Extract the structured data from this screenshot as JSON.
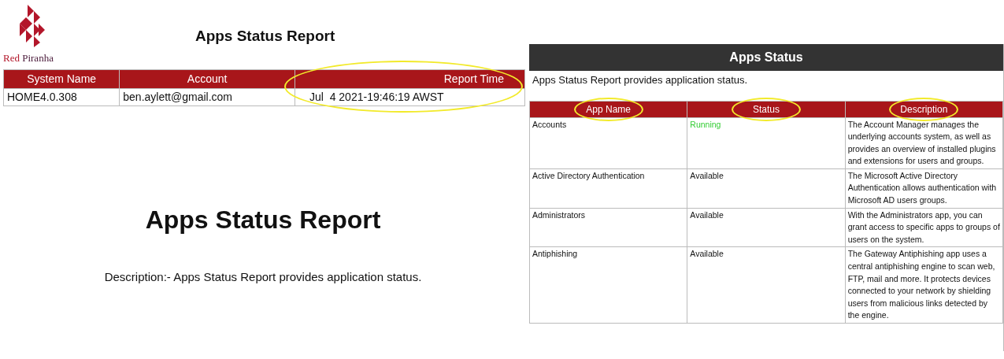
{
  "logo": {
    "word_1": "Red",
    "word_2": "Piranha"
  },
  "header_title": "Apps Status Report",
  "summary_table": {
    "columns": [
      {
        "label": "System Name",
        "circled": false
      },
      {
        "label": "Account",
        "circled": false
      },
      {
        "label": "Report Time",
        "circled": true
      }
    ],
    "row": [
      "HOME4.0.308",
      "ben.aylett@gmail.com",
      "Jul  4 2021-19:46:19 AWST"
    ]
  },
  "cover_title": "Apps Status Report",
  "cover_description": "Description:- Apps Status Report provides application status.",
  "section": {
    "title": "Apps Status",
    "intro": "Apps Status Report provides application status.",
    "columns": [
      {
        "label": "App Name",
        "circled": true
      },
      {
        "label": "Status",
        "circled": true
      },
      {
        "label": "Description",
        "circled": true
      }
    ],
    "rows": [
      {
        "app_name": "Accounts",
        "status": "Running",
        "color": "#33cc33",
        "description": "The Account Manager manages the underlying accounts system, as well as provides an overview of installed plugins and extensions for users and groups."
      },
      {
        "app_name": "Active Directory Authentication",
        "status": "Available",
        "color": "#111111",
        "description": "The Microsoft Active Directory Authentication allows authentication with Microsoft AD users groups."
      },
      {
        "app_name": "Administrators",
        "status": "Available",
        "color": "#111111",
        "description": "With the Administrators app, you can grant access to specific apps to groups of users on the system."
      },
      {
        "app_name": "Antiphishing",
        "status": "Available",
        "color": "#111111",
        "description": "The Gateway Antiphishing app uses a central antiphishing engine to scan web, FTP, mail and more. It protects devices connected to your network by shielding users from malicious links detected by the engine."
      }
    ]
  }
}
